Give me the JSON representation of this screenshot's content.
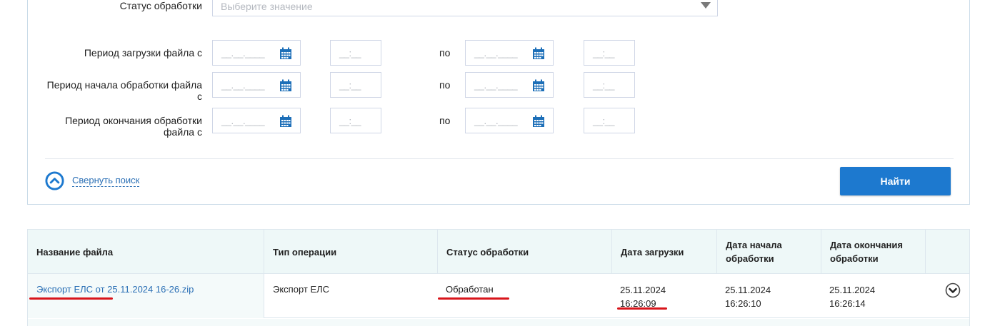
{
  "filters": {
    "status_label": "Статус обработки",
    "status_placeholder": "Выберите значение",
    "upload_label": "Период загрузки файла с",
    "start_label_1": "Период начала обработки файла",
    "start_label_2": "с",
    "end_label_1": "Период окончания обработки",
    "end_label_2": "файла с",
    "po": "по",
    "date_mask": "__.__.____",
    "time_mask": "__:__",
    "collapse_label": "Свернуть поиск",
    "find_label": "Найти"
  },
  "table": {
    "headers": {
      "filename": "Название файла",
      "op_type": "Тип операции",
      "status": "Статус обработки",
      "upload_date": "Дата загрузки",
      "start_date_1": "Дата начала",
      "start_date_2": "обработки",
      "end_date_1": "Дата окончания",
      "end_date_2": "обработки"
    },
    "rows": [
      {
        "filename": "Экспорт ЕЛС от 25.11.2024 16-26.zip",
        "op_type": "Экспорт ЕЛС",
        "status": "Обработан",
        "upload_date": "25.11.2024",
        "upload_time": "16:26:09",
        "start_date": "25.11.2024",
        "start_time": "16:26:10",
        "end_date": "25.11.2024",
        "end_time": "16:26:14"
      }
    ]
  },
  "icons": {
    "calendar": "calendar-icon",
    "collapse": "chevron-up-circle-icon",
    "expand": "chevron-down-circle-icon"
  },
  "colors": {
    "accent": "#1d79cf",
    "link": "#2a6fb5",
    "annotation": "#d8151b",
    "header_bg": "#eef8f8"
  }
}
